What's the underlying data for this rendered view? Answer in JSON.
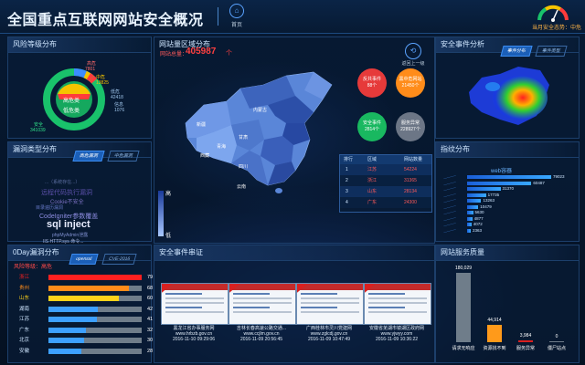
{
  "header": {
    "title": "全国重点互联网网站安全概况",
    "home_label": "首页",
    "safety_text": "当月安全态势：中危"
  },
  "risk": {
    "title": "风险等级分布",
    "legend": [
      {
        "label": "高危",
        "value": "7801",
        "color": "#ff3b3b"
      },
      {
        "label": "中危",
        "value": "13825",
        "color": "#f5c400"
      },
      {
        "label": "低危",
        "value": "42418",
        "color": "#3b8cff"
      },
      {
        "label": "信息",
        "value": "1076",
        "color": "#2ad0ff"
      },
      {
        "label": "安全",
        "value": "341039",
        "color": "#19c26b"
      }
    ],
    "donut_center": "高危类",
    "donut_inner": "低危类"
  },
  "vuln_type": {
    "title": "漏洞类型分布",
    "tab1": "高危漏洞",
    "tab2": "中危漏洞",
    "words": [
      "...（系统存在...）",
      "远程代码执行漏洞",
      "Cookie不安全",
      "目录遍历漏洞",
      "CodeIgniter参数覆盖",
      "sql inject",
      "phpMyAdmin泄露",
      "IIS HTTP.sys 命令..."
    ]
  },
  "zero_day": {
    "title": "0Day漏洞分布",
    "tab1": "openssl",
    "tab2": "CVE-2016",
    "subtitle": "风险等级：高危",
    "rows": [
      {
        "name": "浙江",
        "value": 79,
        "color": "#ff2020"
      },
      {
        "name": "贵州",
        "value": 68,
        "color": "#ff8c1a"
      },
      {
        "name": "山东",
        "value": 60,
        "color": "#ffd21a"
      },
      {
        "name": "湖南",
        "value": 42,
        "color": "#3da0ff"
      },
      {
        "name": "江苏",
        "value": 41,
        "color": "#3da0ff"
      },
      {
        "name": "广东",
        "value": 32,
        "color": "#3da0ff"
      },
      {
        "name": "北京",
        "value": 30,
        "color": "#3da0ff"
      },
      {
        "name": "安徽",
        "value": 28,
        "color": "#3da0ff"
      }
    ]
  },
  "map": {
    "title": "网站量区域分布",
    "total_label": "网站总量：",
    "total_value": "405987",
    "total_unit": "个",
    "back_label": "返回上一级",
    "legend_high": "高",
    "legend_low": "低",
    "labels": [
      {
        "t": "新疆"
      },
      {
        "t": "西藏"
      },
      {
        "t": "青海"
      },
      {
        "t": "甘肃"
      },
      {
        "t": "四川"
      },
      {
        "t": "内蒙古"
      },
      {
        "t": "云南"
      }
    ],
    "bubbles": [
      {
        "label": "反共事件",
        "value": "88个",
        "color": "#ff3b3b"
      },
      {
        "label": "黑中危网站",
        "value": "21450个",
        "color": "#ff8c1a"
      },
      {
        "label": "安全事件",
        "value": "2814个",
        "color": "#19c26b"
      },
      {
        "label": "服务异常",
        "value": "228927个",
        "color": "#7d8797"
      }
    ],
    "rank": {
      "headers": [
        "排行",
        "区域",
        "网站数量"
      ],
      "rows": [
        [
          "1",
          "江苏",
          "54224"
        ],
        [
          "2",
          "浙江",
          "31365"
        ],
        [
          "3",
          "山东",
          "28134"
        ],
        [
          "4",
          "广东",
          "24300"
        ]
      ]
    }
  },
  "event_analysis": {
    "title": "安全事件分析",
    "tab1": "事件分布",
    "tab2": "事件类型"
  },
  "index_dist": {
    "title": "指纹分布",
    "chart_title": "web容器",
    "values": [
      "79023",
      "60487",
      "31370",
      "17735",
      "13263",
      "10479",
      "5630",
      "4877",
      "4072",
      "2363"
    ]
  },
  "event_serial": {
    "title": "安全事件串证",
    "items": [
      {
        "name": "黑龙江省办事服务网",
        "url": "www.hrbzb.gov.cn",
        "time": "2016-11-10 09:29:06"
      },
      {
        "name": "吉林长春高速公路交通...",
        "url": "www.ccjlm.gov.cn",
        "time": "2016-11-09 20:56:45"
      },
      {
        "name": "广西桂林市灵川党建网",
        "url": "www.zglcdj.gov.cn",
        "time": "2016-11-09 10:47:49"
      },
      {
        "name": "安徽省芜湖市镜湖区政府网",
        "url": "www.yjwyy.com",
        "time": "2016-11-09 10:36:22"
      }
    ]
  },
  "service": {
    "title": "网站服务质量",
    "chart_data": {
      "type": "bar",
      "categories": [
        "请求无响应",
        "资源找不到",
        "服务异常",
        "僵尸站点"
      ],
      "values": [
        180029,
        44914,
        3984,
        0
      ],
      "labels": [
        "180,029",
        "44,914",
        "3,984",
        "0"
      ],
      "colors": [
        "#6f7d8a",
        "#ff9a1a",
        "#d92020",
        "#6f7d8a"
      ]
    }
  }
}
